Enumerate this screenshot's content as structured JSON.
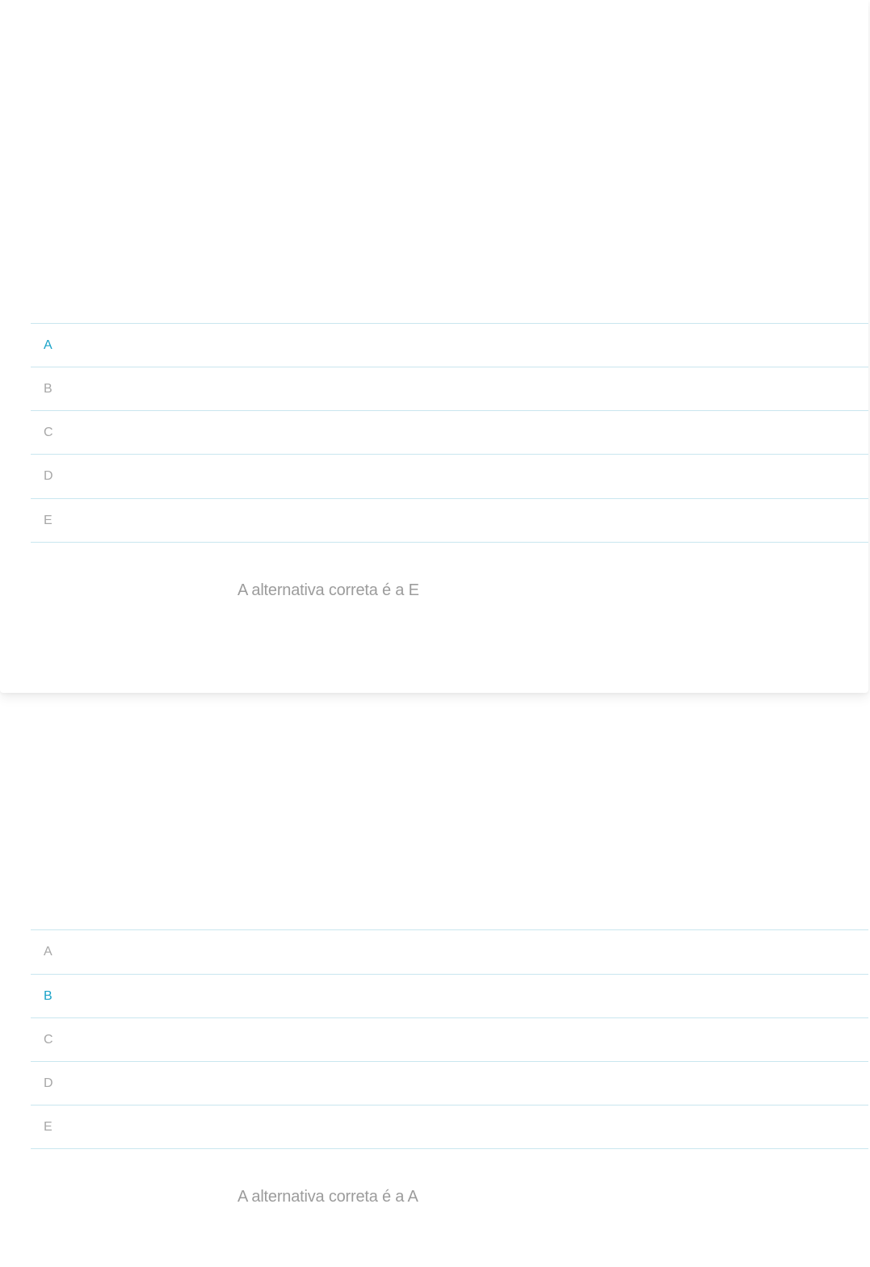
{
  "questions": [
    {
      "options": [
        {
          "letter": "A",
          "selected": true
        },
        {
          "letter": "B",
          "selected": false
        },
        {
          "letter": "C",
          "selected": false
        },
        {
          "letter": "D",
          "selected": false
        },
        {
          "letter": "E",
          "selected": false
        }
      ],
      "answer_text": "A alternativa correta é a E"
    },
    {
      "options": [
        {
          "letter": "A",
          "selected": false
        },
        {
          "letter": "B",
          "selected": true
        },
        {
          "letter": "C",
          "selected": false
        },
        {
          "letter": "D",
          "selected": false
        },
        {
          "letter": "E",
          "selected": false
        }
      ],
      "answer_text": "A alternativa correta é a A"
    }
  ],
  "colors": {
    "selected_option": "#1aa3c8",
    "unselected_option": "#a7a7a7",
    "divider": "#c9e6ef",
    "answer_text": "#9c9c9c"
  }
}
